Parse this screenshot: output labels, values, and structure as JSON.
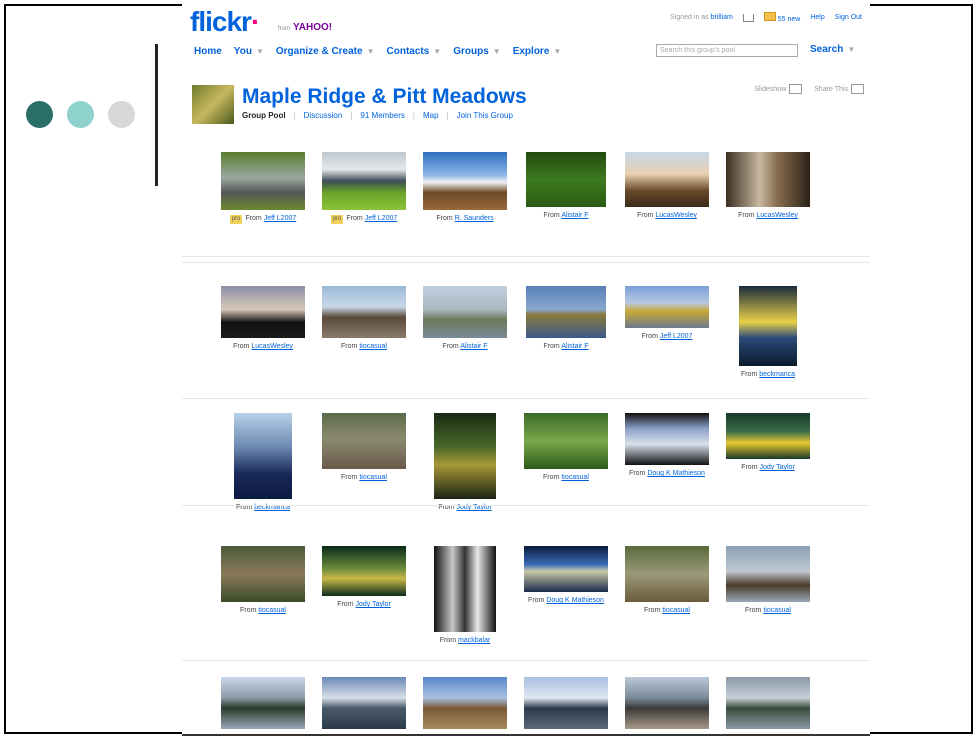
{
  "header": {
    "logo": "flickr",
    "logo_dot": "·",
    "yahoo_prefix": "from",
    "yahoo": "YAHOO!",
    "signed_in_label": "Signed in as",
    "username": "brilliam",
    "mail_count": "55 new",
    "help": "Help",
    "sign_out": "Sign Out"
  },
  "nav": {
    "home": "Home",
    "you": "You",
    "organize": "Organize & Create",
    "contacts": "Contacts",
    "groups": "Groups",
    "explore": "Explore",
    "caret": "▼",
    "search_placeholder": "Search this group's pool",
    "search_button": "Search"
  },
  "group": {
    "title": "Maple Ridge & Pitt Meadows",
    "tabs": [
      "Group Pool",
      "Discussion",
      "91 Members",
      "Map",
      "Join This Group"
    ],
    "separator": "|",
    "slideshow": "Slideshow",
    "share": "Share This"
  },
  "colors": {
    "accent": "#0063dc",
    "logo_pink": "#ff0084",
    "dot1": "#2a6e68",
    "dot2": "#8fd1cc",
    "dot3": "#d8d8d8"
  },
  "photos": [
    {
      "from": "From",
      "user": "Jeff L2007",
      "badge": "pro"
    },
    {
      "from": "From",
      "user": "Jeff L2007",
      "badge": "pro"
    },
    {
      "from": "From",
      "user": "R. Saunders"
    },
    {
      "from": "From",
      "user": "Alistair F"
    },
    {
      "from": "From",
      "user": "LucasWesley"
    },
    {
      "from": "From",
      "user": "LucasWesley"
    },
    {
      "from": "From",
      "user": "LucasWesley"
    },
    {
      "from": "From",
      "user": "tiocasual"
    },
    {
      "from": "From",
      "user": "Alistair F"
    },
    {
      "from": "From",
      "user": "Alistair F"
    },
    {
      "from": "From",
      "user": "Jeff L2007"
    },
    {
      "from": "From",
      "user": "beckmanca"
    },
    {
      "from": "From",
      "user": "beckmanca"
    },
    {
      "from": "From",
      "user": "tiocasual"
    },
    {
      "from": "From",
      "user": "Jody Taylor"
    },
    {
      "from": "From",
      "user": "tiocasual"
    },
    {
      "from": "From",
      "user": "Doug K Mathieson"
    },
    {
      "from": "From",
      "user": "Jody Taylor"
    },
    {
      "from": "From",
      "user": "tiocasual"
    },
    {
      "from": "From",
      "user": "Jody Taylor"
    },
    {
      "from": "From",
      "user": "mackbalar"
    },
    {
      "from": "From",
      "user": "Doug K Mathieson"
    },
    {
      "from": "From",
      "user": "tiocasual"
    },
    {
      "from": "From",
      "user": "tiocasual"
    },
    {
      "user": ""
    },
    {
      "user": ""
    },
    {
      "user": ""
    },
    {
      "user": ""
    },
    {
      "user": ""
    },
    {
      "user": ""
    }
  ]
}
